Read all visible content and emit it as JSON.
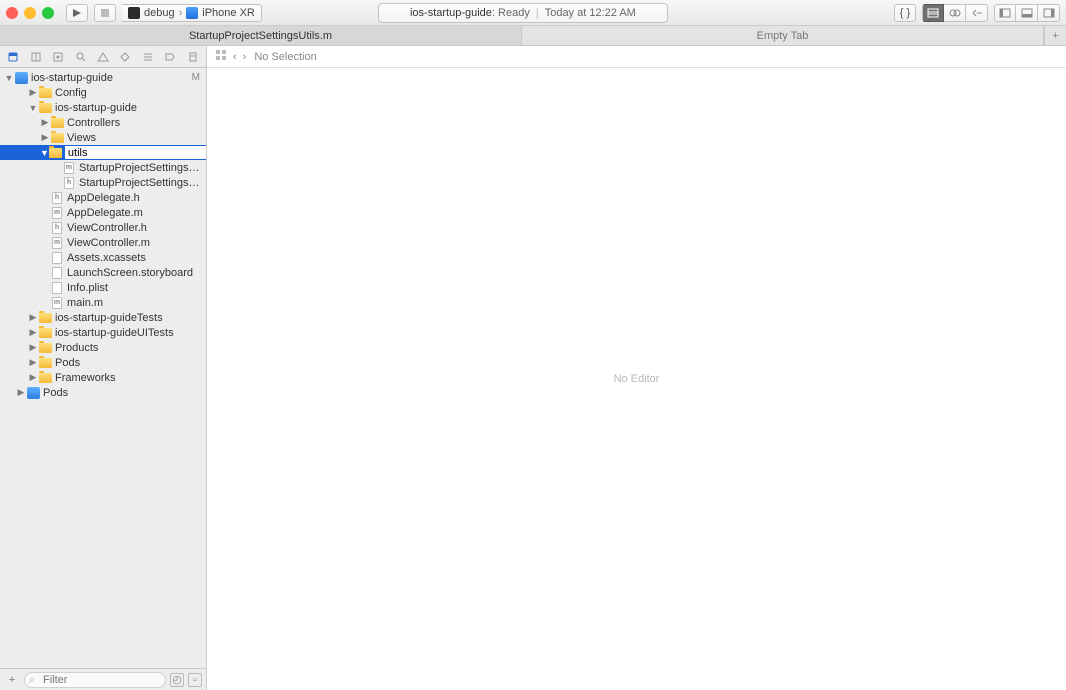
{
  "toolbar": {
    "scheme_name": "debug",
    "device_name": "iPhone XR"
  },
  "status": {
    "project": "ios-startup-guide",
    "state": "Ready",
    "timestamp": "Today at 12:22 AM"
  },
  "tabs": {
    "active": "StartupProjectSettingsUtils.m",
    "empty": "Empty Tab"
  },
  "jumpbar": {
    "no_selection": "No Selection"
  },
  "editor": {
    "placeholder": "No Editor"
  },
  "navfooter": {
    "filter_placeholder": "Filter"
  },
  "tree": {
    "root": {
      "label": "ios-startup-guide",
      "badge": "M"
    },
    "rename_value": "utils",
    "items": [
      {
        "indent": 1,
        "kind": "folder",
        "disc": "closed",
        "label": "Config"
      },
      {
        "indent": 1,
        "kind": "folder",
        "disc": "open",
        "label": "ios-startup-guide"
      },
      {
        "indent": 2,
        "kind": "folder",
        "disc": "closed",
        "label": "Controllers"
      },
      {
        "indent": 2,
        "kind": "folder",
        "disc": "closed",
        "label": "Views"
      },
      {
        "indent": 2,
        "kind": "folder",
        "disc": "open",
        "label": "",
        "selected_rename": true
      },
      {
        "indent": 3,
        "kind": "file",
        "ext": "m",
        "label": "StartupProjectSettingsUtils.m"
      },
      {
        "indent": 3,
        "kind": "file",
        "ext": "h",
        "label": "StartupProjectSettingsUtils.h"
      },
      {
        "indent": 2,
        "kind": "file",
        "ext": "h",
        "label": "AppDelegate.h"
      },
      {
        "indent": 2,
        "kind": "file",
        "ext": "m",
        "label": "AppDelegate.m"
      },
      {
        "indent": 2,
        "kind": "file",
        "ext": "h",
        "label": "ViewController.h"
      },
      {
        "indent": 2,
        "kind": "file",
        "ext": "m",
        "label": "ViewController.m"
      },
      {
        "indent": 2,
        "kind": "file",
        "ext": "",
        "label": "Assets.xcassets"
      },
      {
        "indent": 2,
        "kind": "file",
        "ext": "",
        "label": "LaunchScreen.storyboard"
      },
      {
        "indent": 2,
        "kind": "file",
        "ext": "",
        "label": "Info.plist"
      },
      {
        "indent": 2,
        "kind": "file",
        "ext": "m",
        "label": "main.m"
      },
      {
        "indent": 1,
        "kind": "folder",
        "disc": "closed",
        "label": "ios-startup-guideTests"
      },
      {
        "indent": 1,
        "kind": "folder",
        "disc": "closed",
        "label": "ios-startup-guideUITests"
      },
      {
        "indent": 1,
        "kind": "folder",
        "disc": "closed",
        "label": "Products"
      },
      {
        "indent": 1,
        "kind": "folder",
        "disc": "closed",
        "label": "Pods"
      },
      {
        "indent": 1,
        "kind": "folder",
        "disc": "closed",
        "label": "Frameworks"
      },
      {
        "indent": 0,
        "kind": "proj",
        "disc": "closed",
        "label": "Pods"
      }
    ]
  }
}
